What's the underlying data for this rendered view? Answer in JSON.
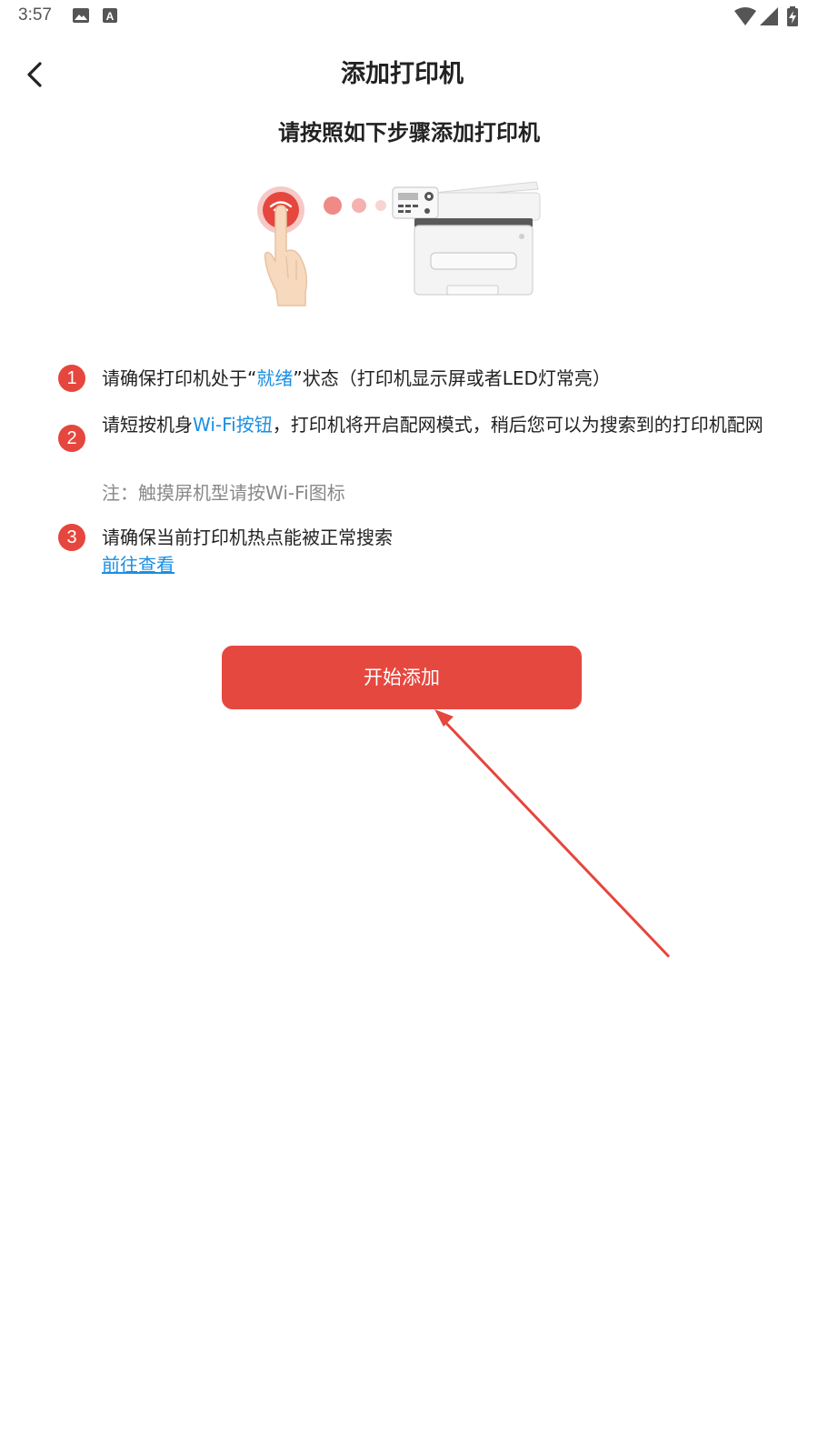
{
  "status_bar": {
    "time": "3:57",
    "icons": [
      "image-icon",
      "text-a-icon",
      "wifi-icon",
      "cell-signal-icon",
      "battery-charging-icon"
    ]
  },
  "header": {
    "back_icon": "chevron-left-icon",
    "title": "添加打印机"
  },
  "subtitle": "请按照如下步骤添加打印机",
  "illustration": {
    "icons": [
      "finger-press-wifi-icon",
      "printer-icon"
    ]
  },
  "steps": [
    {
      "number": "1",
      "text_before": "请确保打印机处于“",
      "highlight": "就绪",
      "text_after": "”状态（打印机显示屏或者LED灯常亮）"
    },
    {
      "number": "2",
      "text_before": "请短按机身",
      "highlight": "Wi-Fi按钮",
      "text_after": "，打印机将开启配网模式，稍后您可以为搜索到的打印机配网",
      "note": "注：触摸屏机型请按Wi-Fi图标"
    },
    {
      "number": "3",
      "text": "请确保当前打印机热点能被正常搜索",
      "link": "前往查看"
    }
  ],
  "start_button": {
    "label": "开始添加"
  },
  "colors": {
    "accent_red": "#e5483f",
    "link_blue": "#1a8fe3",
    "note_gray": "#888888"
  }
}
